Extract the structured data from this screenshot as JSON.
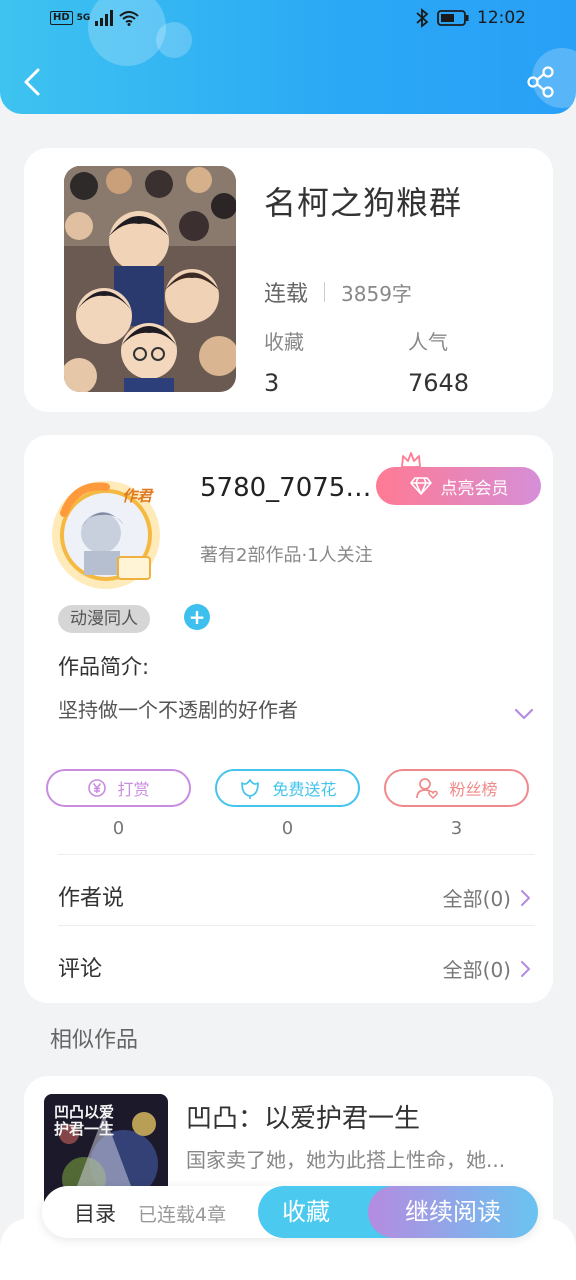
{
  "status_bar": {
    "hd": "HD",
    "network": "5G",
    "time": "12:02"
  },
  "book": {
    "title": "名柯之狗粮群",
    "status": "连载",
    "word_count": "3859字",
    "favorites_label": "收藏",
    "favorites": "3",
    "popularity_label": "人气",
    "popularity": "7648"
  },
  "author": {
    "name": "5780_70758...",
    "avatar_badge": "作君",
    "vip_button": "点亮会员",
    "meta": "著有2部作品·1人关注",
    "tag": "动漫同人",
    "add_tag": "+",
    "intro_label": "作品简介:",
    "intro_text": "坚持做一个不透剧的好作者",
    "actions": [
      {
        "label": "打赏",
        "value": "0",
        "color": "#c88de0",
        "icon": "yen-icon"
      },
      {
        "label": "免费送花",
        "value": "0",
        "color": "#45c4ec",
        "icon": "flower-icon"
      },
      {
        "label": "粉丝榜",
        "value": "3",
        "color": "#f08a8a",
        "icon": "fan-icon"
      }
    ],
    "author_says_label": "作者说",
    "author_says_link": "全部(0)",
    "comments_label": "评论",
    "comments_link": "全部(0)"
  },
  "similar": {
    "section_title": "相似作品",
    "items": [
      {
        "title": "凹凸：以爱护君一生",
        "desc": "国家卖了她，她为此搭上性命，她...",
        "cover_text": "凹凸以爱护君一生"
      }
    ]
  },
  "bottom_bar": {
    "toc": "目录",
    "chapters": "已连载4章",
    "favorite": "收藏",
    "continue_reading": "继续阅读"
  },
  "colors": {
    "header_start": "#3ec3f0",
    "header_end": "#29a0f7",
    "vip_start": "#ff7a93",
    "vip_end": "#d68fd8",
    "accent_blue": "#4bc9ef"
  }
}
